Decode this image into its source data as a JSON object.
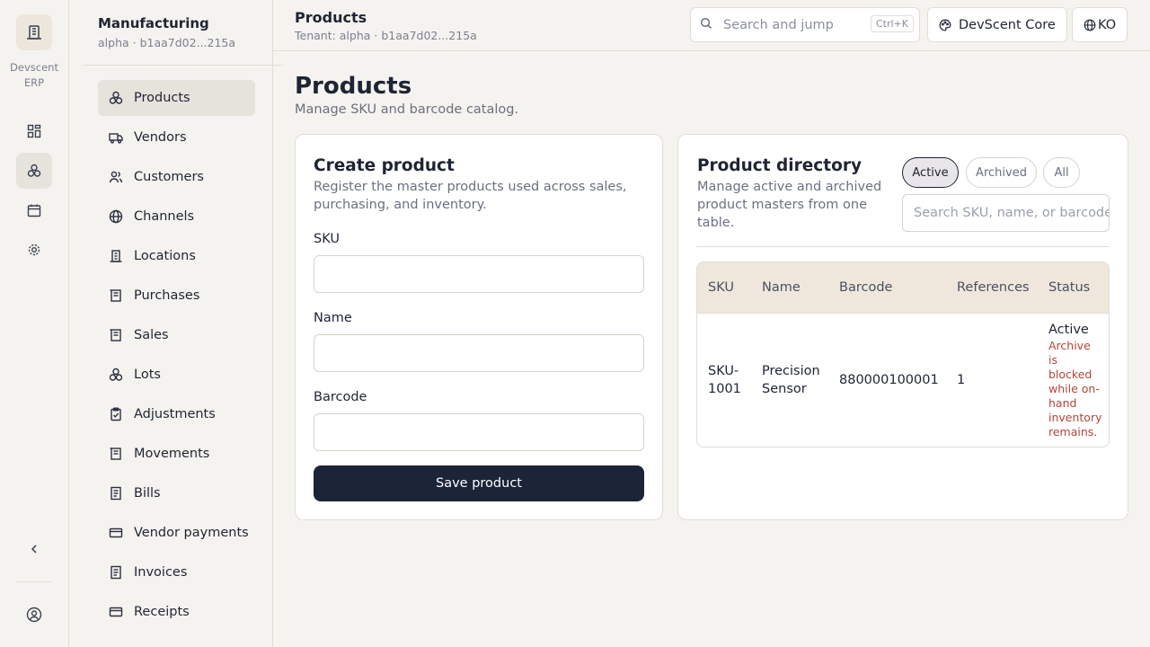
{
  "rail": {
    "brand_line1": "Devscent",
    "brand_line2": "ERP"
  },
  "sidebar": {
    "title": "Manufacturing",
    "subtitle": "alpha · b1aa7d02...215a",
    "items": [
      {
        "label": "Products",
        "icon": "cubes-icon"
      },
      {
        "label": "Vendors",
        "icon": "truck-icon"
      },
      {
        "label": "Customers",
        "icon": "users-icon"
      },
      {
        "label": "Channels",
        "icon": "globe-icon"
      },
      {
        "label": "Locations",
        "icon": "building-icon"
      },
      {
        "label": "Purchases",
        "icon": "receipt-icon"
      },
      {
        "label": "Sales",
        "icon": "receipt-icon"
      },
      {
        "label": "Lots",
        "icon": "cubes-icon"
      },
      {
        "label": "Adjustments",
        "icon": "clipboard-icon"
      },
      {
        "label": "Movements",
        "icon": "receipt-icon"
      },
      {
        "label": "Bills",
        "icon": "document-icon"
      },
      {
        "label": "Vendor payments",
        "icon": "card-icon"
      },
      {
        "label": "Invoices",
        "icon": "document-icon"
      },
      {
        "label": "Receipts",
        "icon": "card-icon"
      }
    ]
  },
  "topbar": {
    "title": "Products",
    "subtitle": "Tenant: alpha · b1aa7d02...215a",
    "search_placeholder": "Search and jump",
    "search_shortcut": "Ctrl+K",
    "theme_label": "DevScent Core",
    "lang_label": "KO"
  },
  "header": {
    "title": "Products",
    "description": "Manage SKU and barcode catalog."
  },
  "create": {
    "title": "Create product",
    "description_line1": "Register the master products used across sales,",
    "description_line2": "purchasing, and inventory.",
    "sku_label": "SKU",
    "name_label": "Name",
    "barcode_label": "Barcode",
    "save_label": "Save product"
  },
  "directory": {
    "title": "Product directory",
    "description_line1": "Manage active and archived",
    "description_line2": "product masters from one",
    "description_line3": "table.",
    "filters": [
      "Active",
      "Archived",
      "All"
    ],
    "search_placeholder": "Search SKU, name, or barcode",
    "columns": [
      "SKU",
      "Name",
      "Barcode",
      "References",
      "Status"
    ],
    "rows": [
      {
        "sku_line1": "SKU-",
        "sku_line2": "1001",
        "name_line1": "Precision",
        "name_line2": "Sensor",
        "barcode": "880000100001",
        "references": "1",
        "status": "Active",
        "warning_lines": [
          "Archive",
          "is",
          "blocked",
          "while on-",
          "hand",
          "inventory",
          "remains."
        ]
      }
    ]
  }
}
